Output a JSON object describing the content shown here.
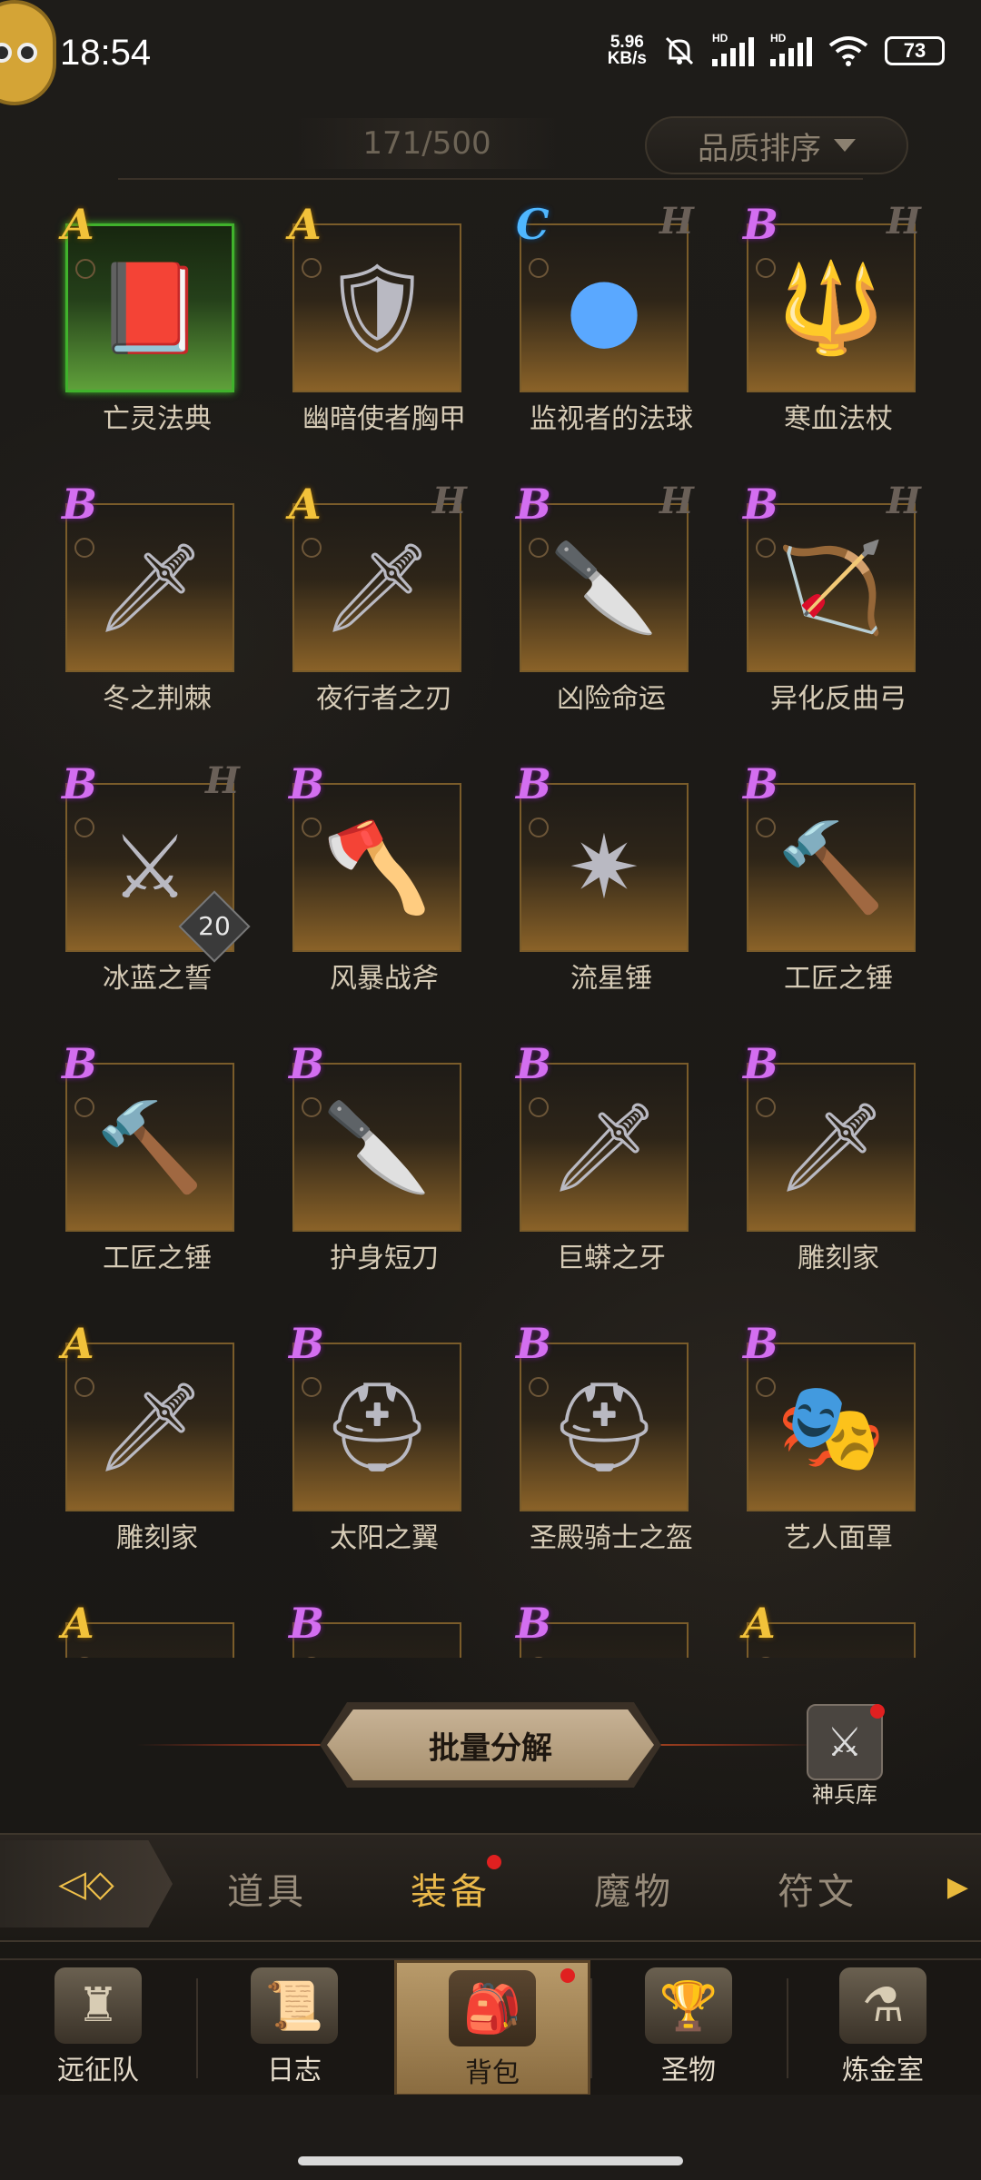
{
  "status_bar": {
    "time": "18:54",
    "net_speed": "5.96",
    "net_unit": "KB/s",
    "hd1": "HD",
    "hd2": "HD",
    "battery": "73"
  },
  "inventory": {
    "count": "171/500",
    "sort_label": "品质排序",
    "items": [
      {
        "name": "亡灵法典",
        "grade": "A",
        "icon": "tome-icon",
        "highlight": true
      },
      {
        "name": "幽暗使者胸甲",
        "grade": "A",
        "icon": "chest-armor-icon"
      },
      {
        "name": "监视者的法球",
        "grade": "C",
        "icon": "orb-icon",
        "hmark": "H"
      },
      {
        "name": "寒血法杖",
        "grade": "B",
        "icon": "staff-icon",
        "hmark": "H"
      },
      {
        "name": "冬之荆棘",
        "grade": "B",
        "icon": "greatsword-icon"
      },
      {
        "name": "夜行者之刃",
        "grade": "A",
        "icon": "dagger-icon",
        "hmark": "H"
      },
      {
        "name": "凶险命运",
        "grade": "B",
        "icon": "knife-icon",
        "hmark": "H"
      },
      {
        "name": "异化反曲弓",
        "grade": "B",
        "icon": "bow-icon",
        "hmark": "H"
      },
      {
        "name": "冰蓝之誓",
        "grade": "B",
        "icon": "ice-sword-icon",
        "hmark": "H",
        "stack": "20"
      },
      {
        "name": "风暴战斧",
        "grade": "B",
        "icon": "axe-icon"
      },
      {
        "name": "流星锤",
        "grade": "B",
        "icon": "mace-icon"
      },
      {
        "name": "工匠之锤",
        "grade": "B",
        "icon": "hammer-icon"
      },
      {
        "name": "工匠之锤",
        "grade": "B",
        "icon": "hammer-icon"
      },
      {
        "name": "护身短刀",
        "grade": "B",
        "icon": "short-blade-icon"
      },
      {
        "name": "巨蟒之牙",
        "grade": "B",
        "icon": "serrated-dagger-icon"
      },
      {
        "name": "雕刻家",
        "grade": "B",
        "icon": "dagger-icon"
      },
      {
        "name": "雕刻家",
        "grade": "A",
        "icon": "dagger-icon"
      },
      {
        "name": "太阳之翼",
        "grade": "B",
        "icon": "winged-helm-icon"
      },
      {
        "name": "圣殿骑士之盔",
        "grade": "B",
        "icon": "knight-helm-icon"
      },
      {
        "name": "艺人面罩",
        "grade": "B",
        "icon": "mask-icon"
      },
      {
        "name": "",
        "grade": "A",
        "icon": "item-icon"
      },
      {
        "name": "",
        "grade": "B",
        "icon": "item-icon"
      },
      {
        "name": "",
        "grade": "B",
        "icon": "item-icon"
      },
      {
        "name": "",
        "grade": "A",
        "icon": "item-icon"
      }
    ]
  },
  "actions": {
    "bulk_decompose": "批量分解",
    "armory_label": "神兵库"
  },
  "category_tabs": {
    "items": [
      {
        "label": "道具",
        "active": false
      },
      {
        "label": "装备",
        "active": true,
        "badge": true
      },
      {
        "label": "魔物",
        "active": false
      },
      {
        "label": "符文",
        "active": false
      }
    ]
  },
  "bottom_nav": {
    "items": [
      {
        "label": "远征队",
        "icon": "horned-helm-icon",
        "active": false
      },
      {
        "label": "日志",
        "icon": "scroll-icon",
        "active": false
      },
      {
        "label": "背包",
        "icon": "backpack-icon",
        "active": true,
        "badge": true
      },
      {
        "label": "圣物",
        "icon": "chalice-icon",
        "active": false
      },
      {
        "label": "炼金室",
        "icon": "alchemy-icon",
        "active": false
      }
    ]
  },
  "colors": {
    "grade_A": "#f2c23a",
    "grade_B": "#d36ef0",
    "grade_C": "#4fb7ff",
    "accent_gold": "#e9b84a",
    "badge_red": "#e02020"
  }
}
